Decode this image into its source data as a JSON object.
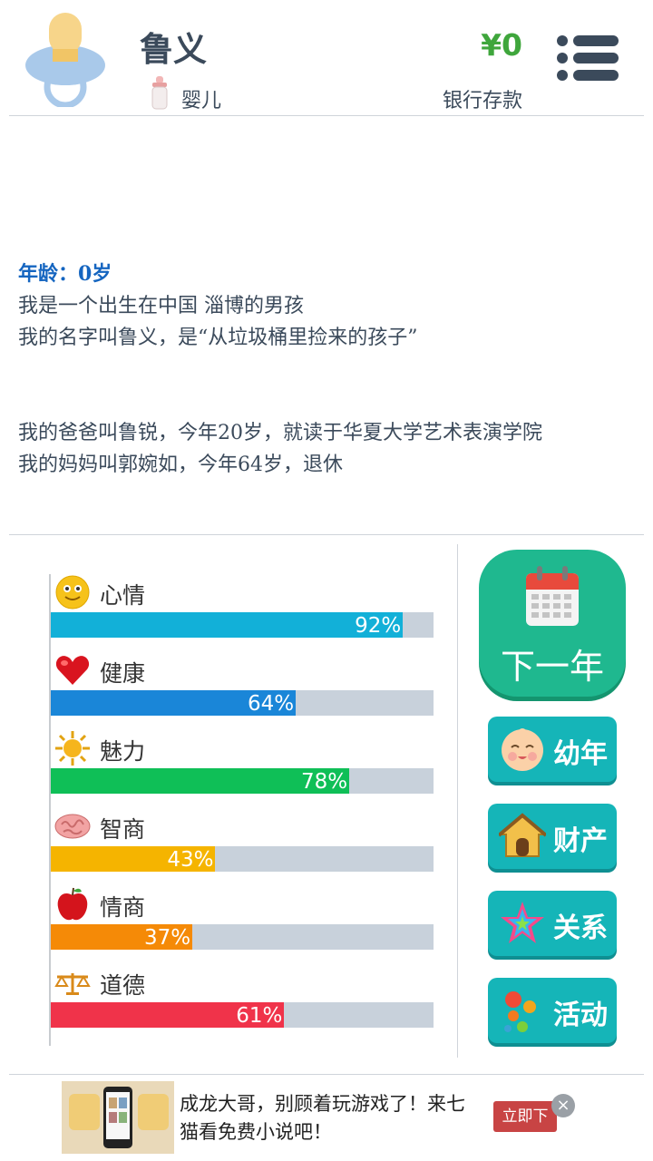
{
  "header": {
    "name": "鲁义",
    "stage": "婴儿",
    "money": "¥0",
    "money_label": "银行存款"
  },
  "story": {
    "age_line": "年龄：0岁",
    "line1": "我是一个出生在中国 淄博的男孩",
    "line2": "我的名字叫鲁义，是“从垃圾桶里捡来的孩子”",
    "line3": "我的爸爸叫鲁锐，今年20岁，就读于华夏大学艺术表演学院",
    "line4": "我的妈妈叫郭婉如，今年64岁，退休"
  },
  "stats": [
    {
      "label": "心情",
      "value": 92,
      "pct": "92%",
      "color": "#12b0d8",
      "icon": "smiley-icon"
    },
    {
      "label": "健康",
      "value": 64,
      "pct": "64%",
      "color": "#1a86d8",
      "icon": "heart-icon"
    },
    {
      "label": "魅力",
      "value": 78,
      "pct": "78%",
      "color": "#0fbf57",
      "icon": "sun-icon"
    },
    {
      "label": "智商",
      "value": 43,
      "pct": "43%",
      "color": "#f5b400",
      "icon": "brain-icon"
    },
    {
      "label": "情商",
      "value": 37,
      "pct": "37%",
      "color": "#f58a07",
      "icon": "apple-icon"
    },
    {
      "label": "道德",
      "value": 61,
      "pct": "61%",
      "color": "#f0334a",
      "icon": "scales-icon"
    }
  ],
  "buttons": {
    "next_year": "下一年",
    "childhood": "幼年",
    "assets": "财产",
    "relations": "关系",
    "activities": "活动"
  },
  "ad": {
    "text": "成龙大哥，别顾着玩游戏了！来七猫看免费小说吧！",
    "cta": "立即下",
    "close": "×"
  }
}
